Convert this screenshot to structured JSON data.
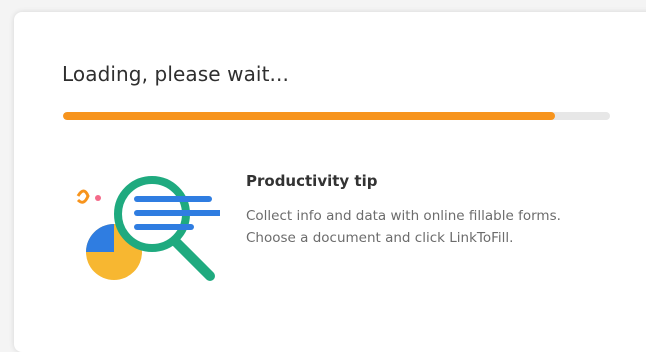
{
  "loading": {
    "title": "Loading, please wait...",
    "progress": 0.9,
    "progress_color": "#f7941d",
    "track_color": "#e7e7e7"
  },
  "tip": {
    "heading": "Productivity tip",
    "line1": "Collect info and data with online fillable forms.",
    "line2": "Choose a document and click LinkToFill.",
    "icon": "magnifier-document-chart-icon"
  },
  "colors": {
    "accent_green": "#1faa7f",
    "accent_blue": "#2f7de1",
    "accent_yellow": "#f7b731",
    "accent_pink": "#f46b8a"
  }
}
